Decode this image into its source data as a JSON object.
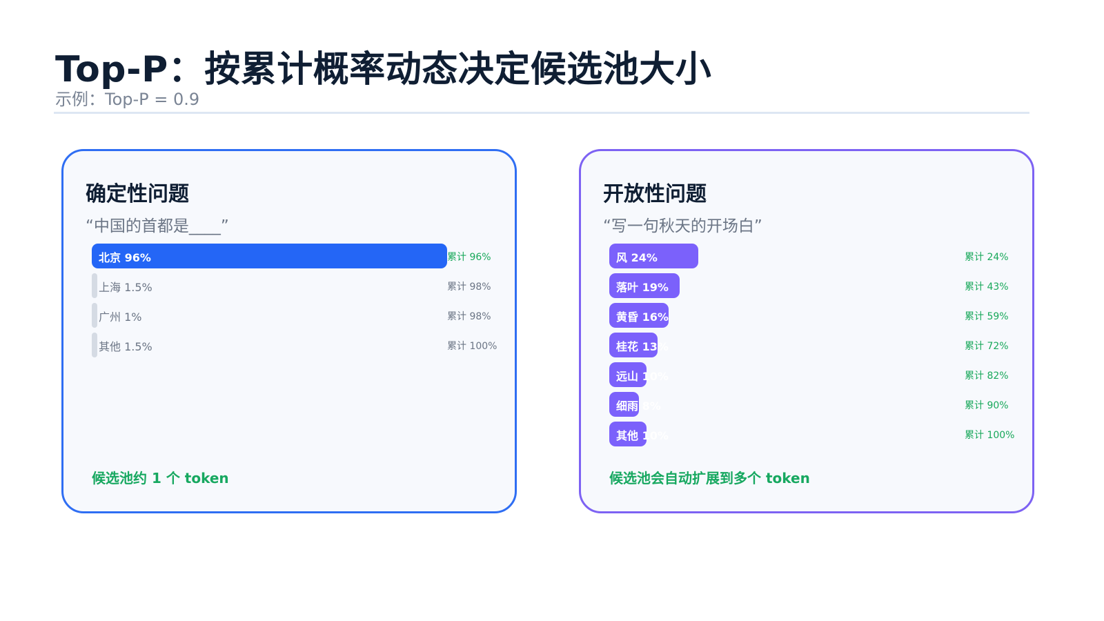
{
  "header": {
    "title": "Top-P：按累计概率动态决定候选池大小",
    "subtitle": "示例：Top-P = 0.9"
  },
  "panels": [
    {
      "title": "确定性问题",
      "prompt": "“中国的首都是____”",
      "accent": "#2f6ef3",
      "note": "候选池约 1 个 token",
      "rows": [
        {
          "label": "北京 96%",
          "prob": 0.96,
          "cumulative": "累计 96%",
          "in_pool": true
        },
        {
          "label": "上海 1.5%",
          "prob": 0.015,
          "cumulative": "累计 98%",
          "in_pool": false
        },
        {
          "label": "广州 1%",
          "prob": 0.01,
          "cumulative": "累计 98%",
          "in_pool": false
        },
        {
          "label": "其他 1.5%",
          "prob": 0.015,
          "cumulative": "累计 100%",
          "in_pool": false
        }
      ]
    },
    {
      "title": "开放性问题",
      "prompt": "“写一句秋天的开场白”",
      "accent": "#7d62f3",
      "note": "候选池会自动扩展到多个 token",
      "rows": [
        {
          "label": "风 24%",
          "prob": 0.24,
          "cumulative": "累计 24%",
          "in_pool": true
        },
        {
          "label": "落叶 19%",
          "prob": 0.19,
          "cumulative": "累计 43%",
          "in_pool": true
        },
        {
          "label": "黄昏 16%",
          "prob": 0.16,
          "cumulative": "累计 59%",
          "in_pool": true
        },
        {
          "label": "桂花 13%",
          "prob": 0.13,
          "cumulative": "累计 72%",
          "in_pool": true
        },
        {
          "label": "远山 10%",
          "prob": 0.1,
          "cumulative": "累计 82%",
          "in_pool": true
        },
        {
          "label": "细雨 8%",
          "prob": 0.08,
          "cumulative": "累计 90%",
          "in_pool": true
        },
        {
          "label": "其他 10%",
          "prob": 0.1,
          "cumulative": "累计 100%",
          "in_pool": true
        }
      ]
    }
  ],
  "colors": {
    "title": "#0f1e33",
    "blue_bar": "#2466f6",
    "purple_bar": "#7b61fb",
    "in_pool_text": "#18a85a",
    "muted_text": "#6b7585"
  }
}
